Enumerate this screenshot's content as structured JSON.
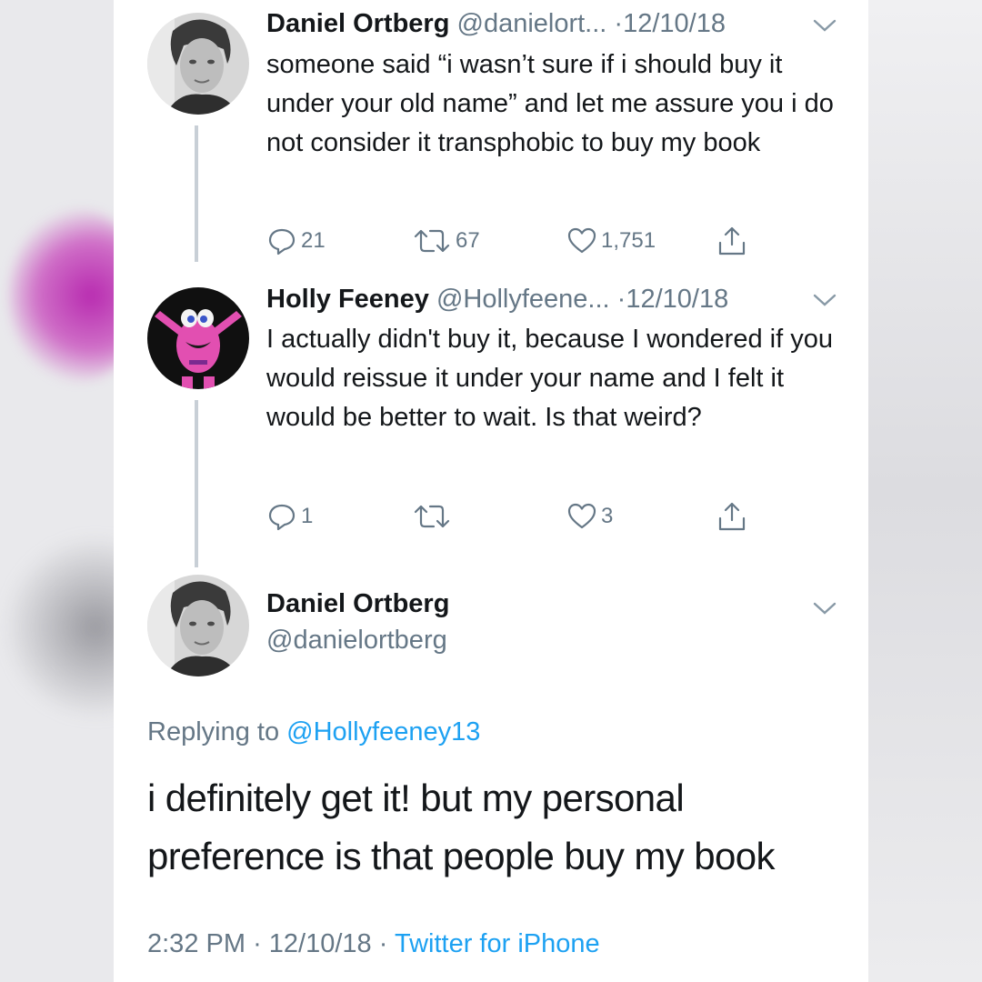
{
  "thread": [
    {
      "author_name": "Daniel Ortberg",
      "handle": "@danielort...",
      "separator": "·",
      "date": "12/10/18",
      "text": "someone said “i wasn’t sure if i should buy it under your old name” and let me assure you i do not consider it transphobic to buy my book",
      "actions": {
        "reply_count": "21",
        "retweet_count": "67",
        "like_count": "1,751"
      }
    },
    {
      "author_name": "Holly Feeney",
      "handle": "@Hollyfeene...",
      "separator": "·",
      "date": "12/10/18",
      "text": "I actually didn't buy it, because I wondered if you would reissue it under your name and I felt it would be better to wait. Is that weird?",
      "actions": {
        "reply_count": "1",
        "retweet_count": "",
        "like_count": "3"
      }
    }
  ],
  "main_tweet": {
    "author_name": "Daniel Ortberg",
    "handle": "@danielortberg",
    "replying_prefix": "Replying to",
    "replying_to": "@Hollyfeeney13",
    "text": "i definitely get it! but my personal preference is that people buy my book",
    "time": "2:32 PM",
    "separator": "·",
    "date": "12/10/18",
    "source": "Twitter for iPhone"
  },
  "icons": {
    "reply": "reply-icon",
    "retweet": "retweet-icon",
    "like": "heart-icon",
    "share": "share-icon",
    "menu": "chevron-down-icon"
  },
  "colors": {
    "text": "#14171a",
    "secondary": "#657786",
    "link": "#1da1f2",
    "thread_line": "#c8cfd6",
    "background_pink_blur": "#b82bb0"
  }
}
